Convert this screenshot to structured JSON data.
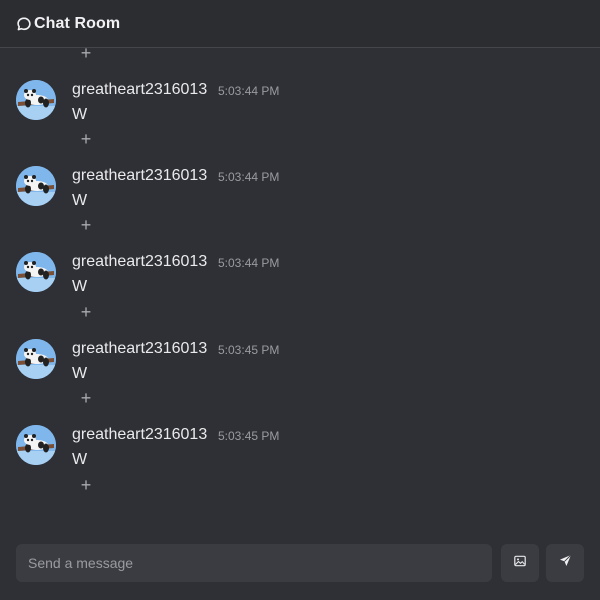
{
  "header": {
    "title": "Chat Room",
    "icon": "chat-bubble-icon"
  },
  "reaction_add_label": "+",
  "messages": [
    {
      "username": "greatheart2316013",
      "time": "5:03:44 PM",
      "text": "W"
    },
    {
      "username": "greatheart2316013",
      "time": "5:03:44 PM",
      "text": "W"
    },
    {
      "username": "greatheart2316013",
      "time": "5:03:44 PM",
      "text": "W"
    },
    {
      "username": "greatheart2316013",
      "time": "5:03:45 PM",
      "text": "W"
    },
    {
      "username": "greatheart2316013",
      "time": "5:03:45 PM",
      "text": "W"
    }
  ],
  "composer": {
    "placeholder": "Send a message",
    "value": ""
  },
  "actions": {
    "image_icon": "image-icon",
    "send_icon": "send-icon"
  },
  "colors": {
    "background": "#2f3035",
    "header_border": "#45464c",
    "input_bg": "#3b3c42",
    "avatar_sky": "#7fb7ec"
  }
}
